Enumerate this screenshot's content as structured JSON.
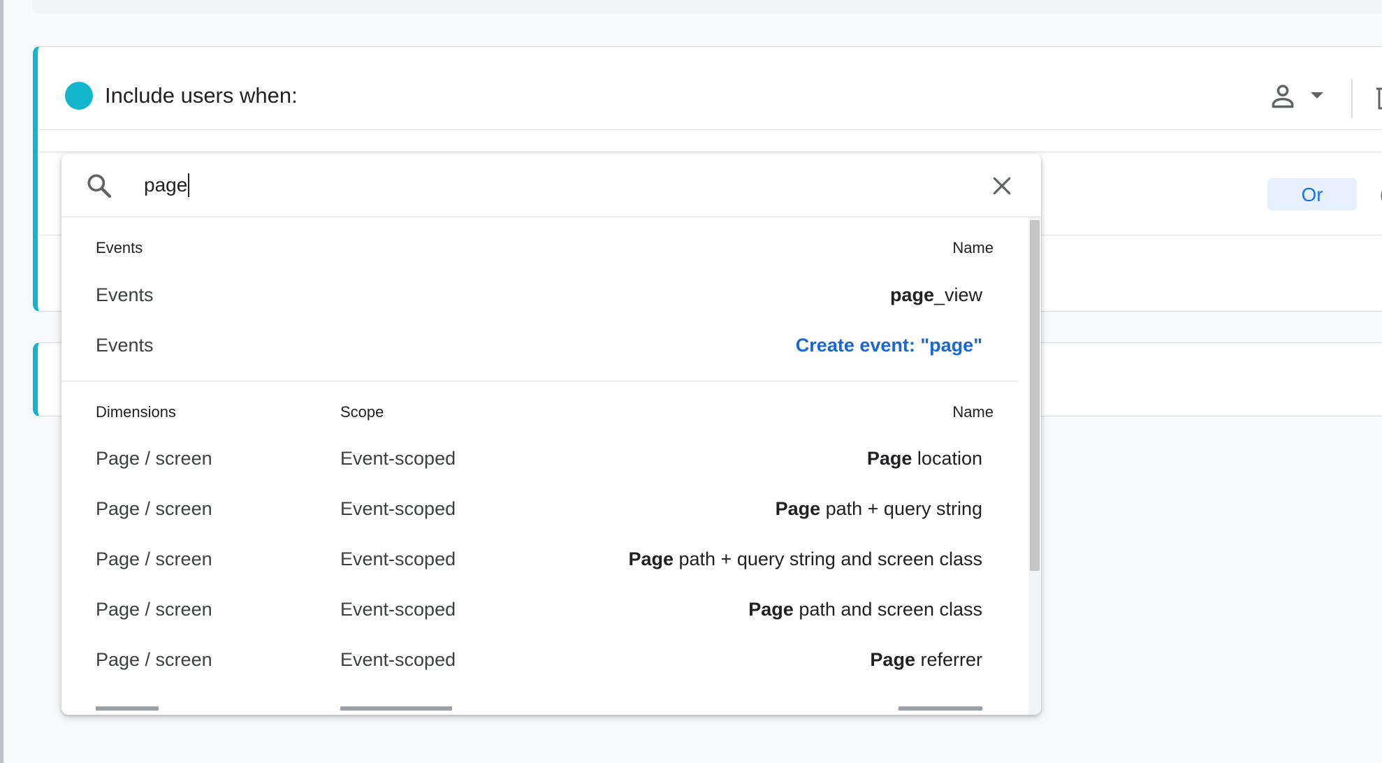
{
  "card": {
    "title": "Include users when:",
    "or_label": "Or"
  },
  "search": {
    "value": "page",
    "placeholder": ""
  },
  "events_section": {
    "headers": {
      "category": "Events",
      "name": "Name"
    },
    "rows": [
      {
        "category": "Events",
        "name_bold": "page",
        "name_rest": "_view"
      },
      {
        "category": "Events",
        "create_label": "Create event: \"page\""
      }
    ]
  },
  "dimensions_section": {
    "headers": {
      "category": "Dimensions",
      "scope": "Scope",
      "name": "Name"
    },
    "rows": [
      {
        "category": "Page / screen",
        "scope": "Event-scoped",
        "name_bold": "Page",
        "name_rest": " location"
      },
      {
        "category": "Page / screen",
        "scope": "Event-scoped",
        "name_bold": "Page",
        "name_rest": " path + query string"
      },
      {
        "category": "Page / screen",
        "scope": "Event-scoped",
        "name_bold": "Page",
        "name_rest": " path + query string and screen class"
      },
      {
        "category": "Page / screen",
        "scope": "Event-scoped",
        "name_bold": "Page",
        "name_rest": " path and screen class"
      },
      {
        "category": "Page / screen",
        "scope": "Event-scoped",
        "name_bold": "Page",
        "name_rest": " referrer"
      }
    ]
  },
  "icons": {
    "search": "search-icon",
    "close": "close-icon",
    "user_scope": "person-icon",
    "dropdown": "caret-down-icon",
    "delete": "trash-icon",
    "help": "help-icon"
  },
  "colors": {
    "accent_teal": "#12b5cb",
    "link_blue": "#1967d2",
    "or_button_bg": "#e8f0fe"
  }
}
